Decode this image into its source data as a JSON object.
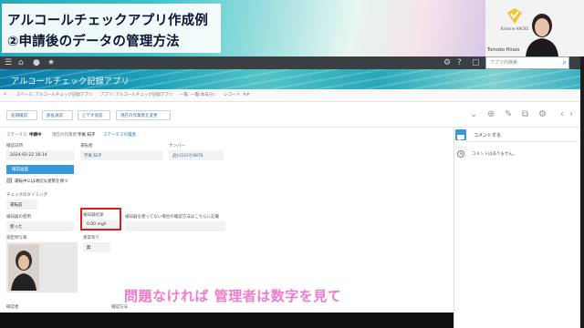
{
  "video": {
    "title_line1": "アルコールチェックアプリ作成例",
    "title_line2": "②申請後のデータの管理方法",
    "logo_text": "Kintone HACKS",
    "presenter_name": "Tomoko Hiraio",
    "caption": "問題なければ 管理者は数字を見て"
  },
  "browser": {
    "search_placeholder": "アプリ内検索"
  },
  "app": {
    "title": "アルコールチェック記録アプリ"
  },
  "breadcrumb": [
    "スペース: アルコールチェック記録アプリ",
    "アプリ: アルコールチェック記録アプリ",
    "一覧: 一覧(本日分)",
    "レコード: ##"
  ],
  "toolbar": {
    "buttons": [
      "初期確認",
      "部長承認",
      "ビデオ承認",
      "現在の作業者を変更"
    ]
  },
  "status": {
    "status_label": "ステータス:",
    "status_value": "申請中",
    "assignee_label": "現在の作業者:",
    "assignee_value": "宇尾 知子",
    "history_link": "ステータスの履歴"
  },
  "fields": {
    "date_label": "確認日時",
    "date_value": "2024-02-22 16:14",
    "driver_label": "運転者",
    "driver_value": "宇尾 知子",
    "plate_label": "ナンバー",
    "plate_value": "品川333ち9876",
    "confirm_button": "確認画面",
    "file_link": "運転中には適切な姿勢を保つ",
    "timing_label": "チェックのタイミング",
    "timing_value": "運転前",
    "device_label": "検知器の使用",
    "device_value": "使った",
    "result_label": "検知器結果",
    "result_value": "0.00 mg/l",
    "no_device_label": "検知器を使ってない場合の確認方法はこちらに記載",
    "abnormal_label": "異常有り",
    "abnormal_value": "無",
    "photo_label": "測定時写真",
    "bottom_label1": "確認者",
    "bottom_label2": "確認方法"
  },
  "comments": {
    "header": "コメントする",
    "empty": "コメントはありません。"
  },
  "colors": {
    "accent": "#3498db",
    "highlight": "#e21a1a",
    "caption": "#f07acc"
  }
}
